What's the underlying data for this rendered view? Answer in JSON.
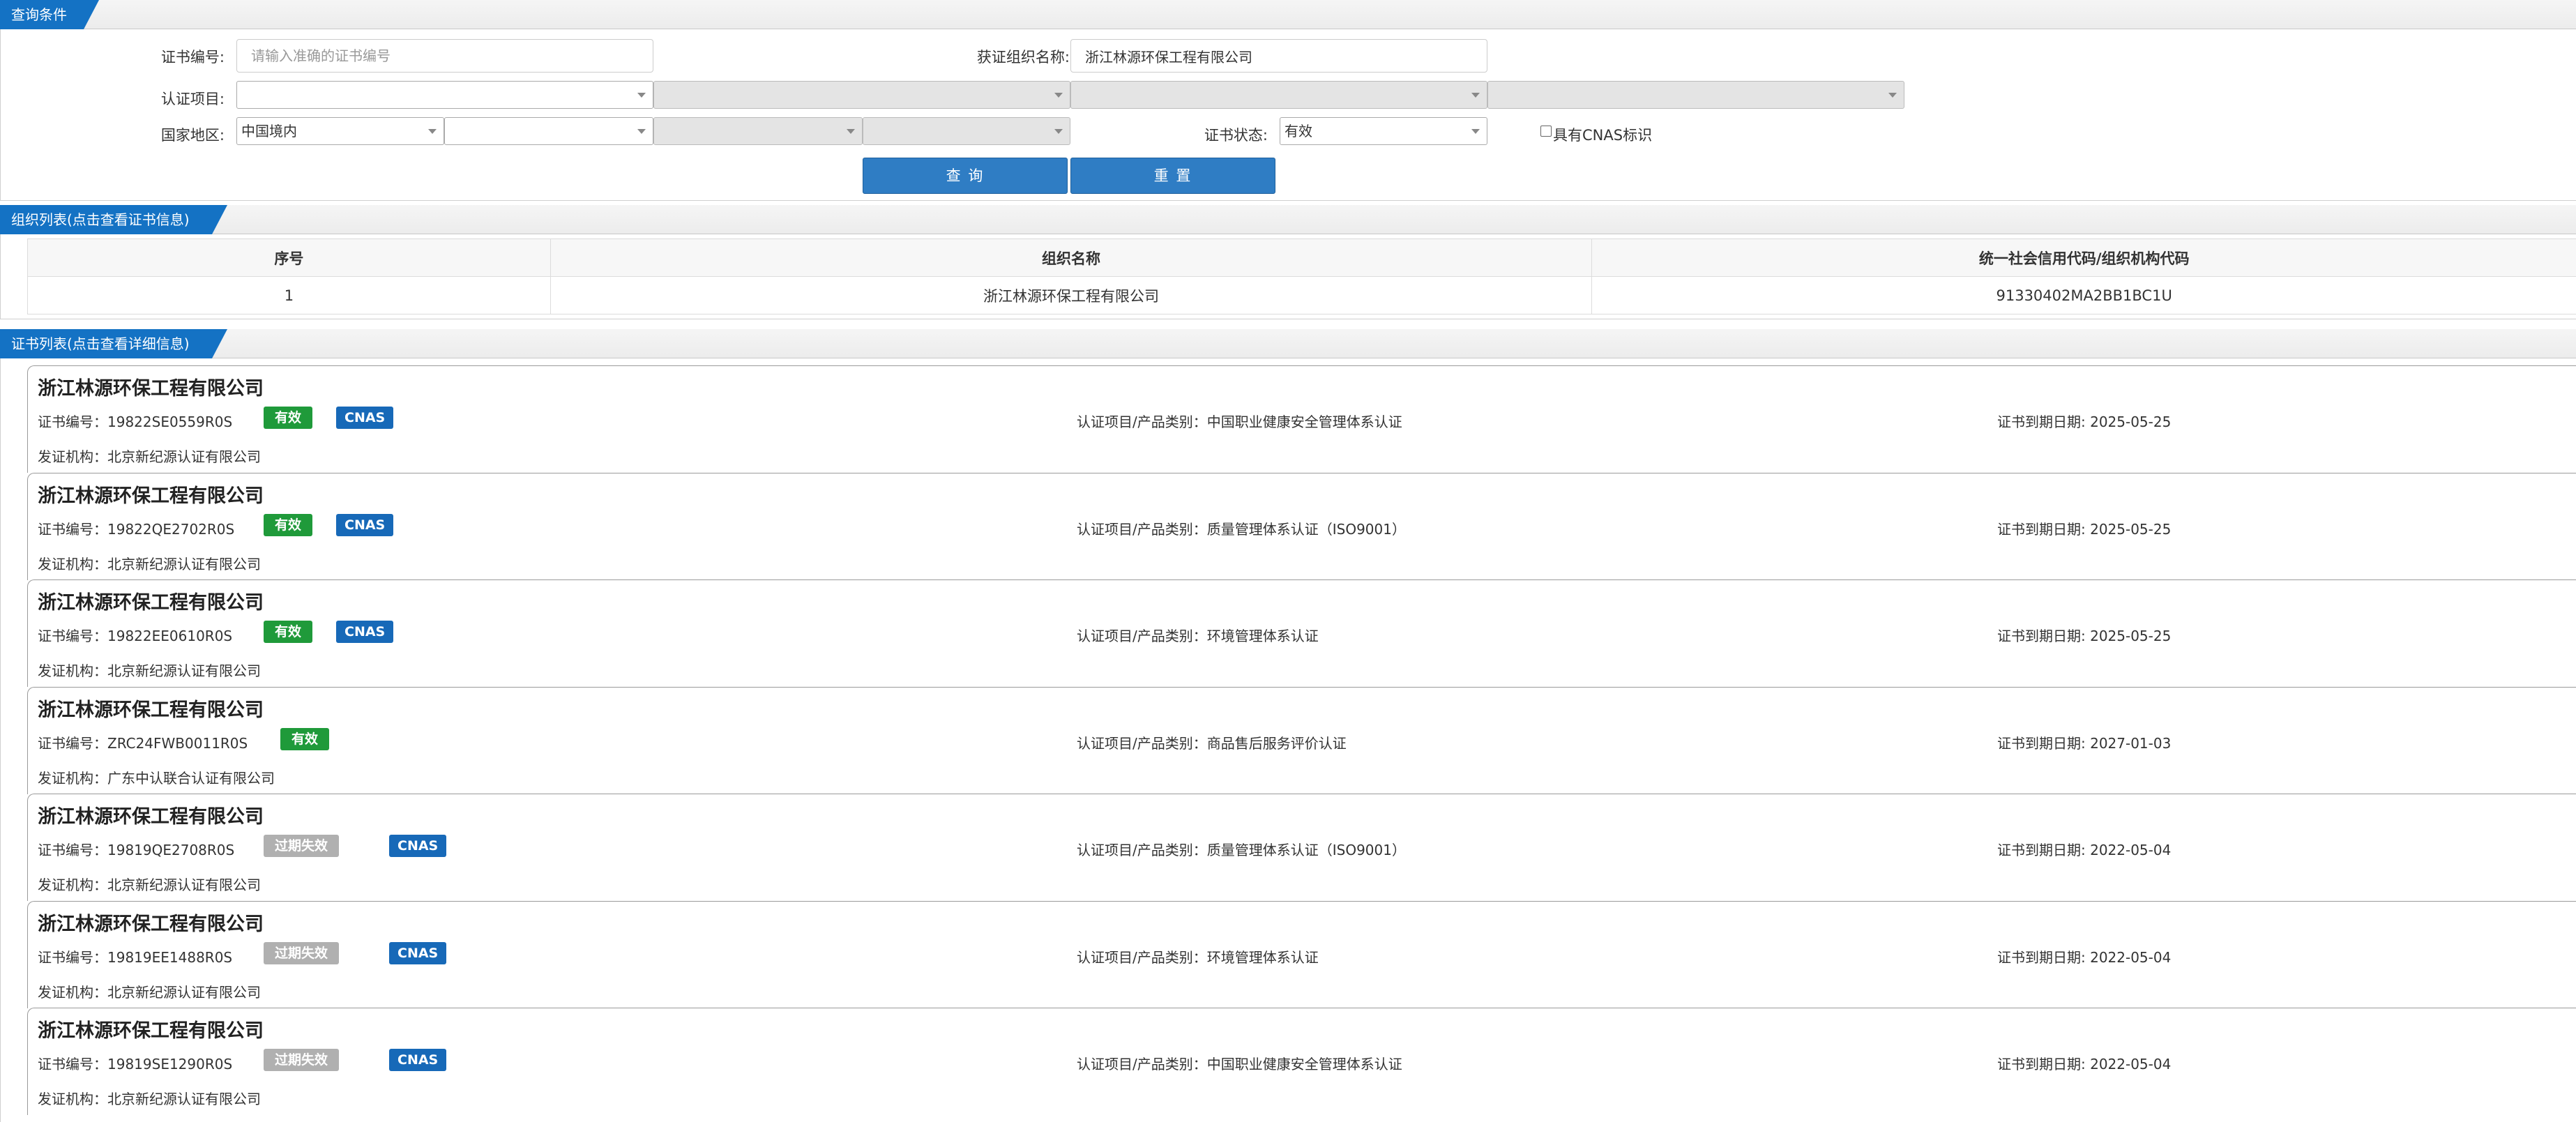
{
  "query": {
    "section_title": "查询条件",
    "cert_no_label": "证书编号:",
    "cert_no_placeholder": "请输入准确的证书编号",
    "org_name_label": "获证组织名称:",
    "org_name_value": "浙江林源环保工程有限公司",
    "cert_item_label": "认证项目:",
    "region_label": "国家地区:",
    "region_value": "中国境内",
    "status_label": "证书状态:",
    "status_value": "有效",
    "cnas_label": "具有CNAS标识",
    "search_button": "查 询",
    "reset_button": "重 置"
  },
  "org_list": {
    "section_title": "组织列表(点击查看证书信息)",
    "columns": [
      "序号",
      "组织名称",
      "统一社会信用代码/组织机构代码"
    ],
    "rows": [
      [
        "1",
        "浙江林源环保工程有限公司",
        "91330402MA2BB1BC1U"
      ]
    ]
  },
  "cert_list": {
    "section_title": "证书列表(点击查看详细信息)",
    "items": [
      {
        "org": "浙江林源环保工程有限公司",
        "cert_no": "证书编号：19822SE0559R0S",
        "status": "有效",
        "status_type": "valid",
        "cnas": "CNAS",
        "item": "认证项目/产品类别：中国职业健康安全管理体系认证",
        "expiry": "证书到期日期: 2025-05-25",
        "issuer": "发证机构：北京新纪源认证有限公司"
      },
      {
        "org": "浙江林源环保工程有限公司",
        "cert_no": "证书编号：19822QE2702R0S",
        "status": "有效",
        "status_type": "valid",
        "cnas": "CNAS",
        "item": "认证项目/产品类别：质量管理体系认证（ISO9001）",
        "expiry": "证书到期日期: 2025-05-25",
        "issuer": "发证机构：北京新纪源认证有限公司"
      },
      {
        "org": "浙江林源环保工程有限公司",
        "cert_no": "证书编号：19822EE0610R0S",
        "status": "有效",
        "status_type": "valid",
        "cnas": "CNAS",
        "item": "认证项目/产品类别：环境管理体系认证",
        "expiry": "证书到期日期: 2025-05-25",
        "issuer": "发证机构：北京新纪源认证有限公司"
      },
      {
        "org": "浙江林源环保工程有限公司",
        "cert_no": "证书编号：ZRC24FWB0011R0S",
        "status": "有效",
        "status_type": "valid",
        "cnas": "",
        "item": "认证项目/产品类别：商品售后服务评价认证",
        "expiry": "证书到期日期: 2027-01-03",
        "issuer": "发证机构：广东中认联合认证有限公司"
      },
      {
        "org": "浙江林源环保工程有限公司",
        "cert_no": "证书编号：19819QE2708R0S",
        "status": "过期失效",
        "status_type": "expired",
        "cnas": "CNAS",
        "item": "认证项目/产品类别：质量管理体系认证（ISO9001）",
        "expiry": "证书到期日期: 2022-05-04",
        "issuer": "发证机构：北京新纪源认证有限公司"
      },
      {
        "org": "浙江林源环保工程有限公司",
        "cert_no": "证书编号：19819EE1488R0S",
        "status": "过期失效",
        "status_type": "expired",
        "cnas": "CNAS",
        "item": "认证项目/产品类别：环境管理体系认证",
        "expiry": "证书到期日期: 2022-05-04",
        "issuer": "发证机构：北京新纪源认证有限公司"
      },
      {
        "org": "浙江林源环保工程有限公司",
        "cert_no": "证书编号：19819SE1290R0S",
        "status": "过期失效",
        "status_type": "expired",
        "cnas": "CNAS",
        "item": "认证项目/产品类别：中国职业健康安全管理体系认证",
        "expiry": "证书到期日期: 2022-05-04",
        "issuer": "发证机构：北京新纪源认证有限公司"
      }
    ]
  },
  "colors": {
    "accent": "#1472c4",
    "valid_badge": "#1f9a3a",
    "expired_badge": "#b0b0b0",
    "cnas_badge": "#1769b8",
    "button": "#2f7dc4"
  }
}
